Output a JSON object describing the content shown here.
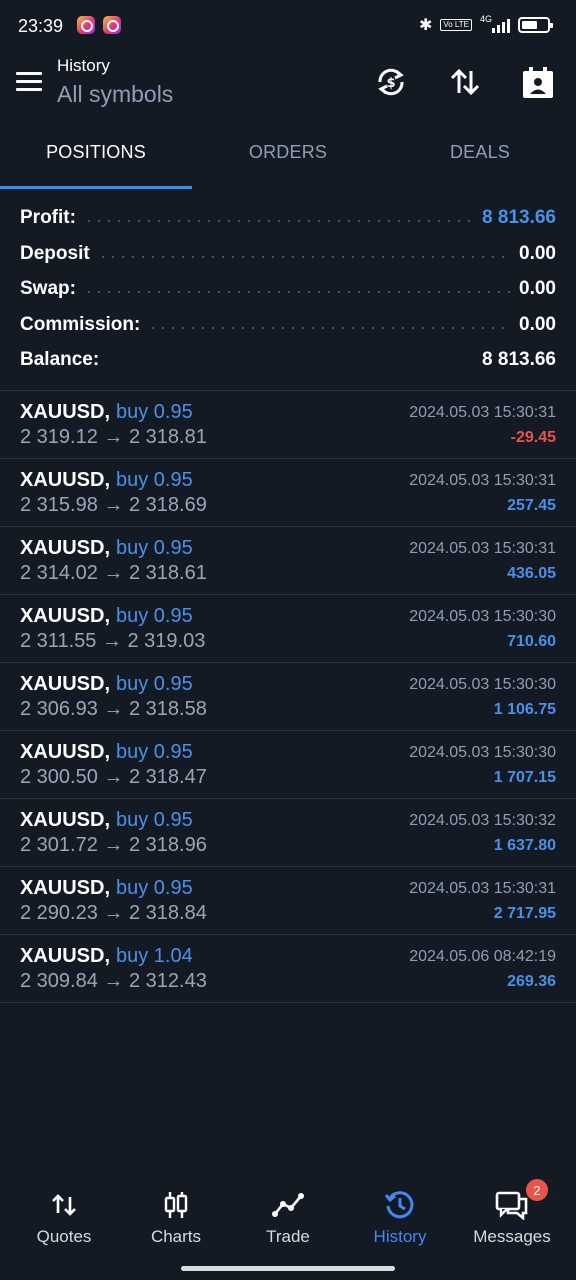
{
  "status_bar": {
    "time": "23:39",
    "network": "4G",
    "volte": "Vo LTE"
  },
  "header": {
    "title": "History",
    "subtitle": "All symbols",
    "icons": [
      "menu-icon",
      "currency-exchange-icon",
      "sort-icon",
      "calendar-icon"
    ]
  },
  "tabs": [
    {
      "label": "POSITIONS",
      "active": true
    },
    {
      "label": "ORDERS",
      "active": false
    },
    {
      "label": "DEALS",
      "active": false
    }
  ],
  "summary": {
    "profit": {
      "label": "Profit:",
      "value": "8 813.66"
    },
    "deposit": {
      "label": "Deposit",
      "value": "0.00"
    },
    "swap": {
      "label": "Swap:",
      "value": "0.00"
    },
    "commission": {
      "label": "Commission:",
      "value": "0.00"
    },
    "balance": {
      "label": "Balance:",
      "value": "8 813.66"
    }
  },
  "deals": [
    {
      "symbol": "XAUUSD,",
      "side": "buy 0.95",
      "prices": "2 319.12 → 2 318.81",
      "time": "2024.05.03 15:30:31",
      "profit": "-29.45",
      "negative": true
    },
    {
      "symbol": "XAUUSD,",
      "side": "buy 0.95",
      "prices": "2 315.98 → 2 318.69",
      "time": "2024.05.03 15:30:31",
      "profit": "257.45",
      "negative": false
    },
    {
      "symbol": "XAUUSD,",
      "side": "buy 0.95",
      "prices": "2 314.02 → 2 318.61",
      "time": "2024.05.03 15:30:31",
      "profit": "436.05",
      "negative": false
    },
    {
      "symbol": "XAUUSD,",
      "side": "buy 0.95",
      "prices": "2 311.55 → 2 319.03",
      "time": "2024.05.03 15:30:30",
      "profit": "710.60",
      "negative": false
    },
    {
      "symbol": "XAUUSD,",
      "side": "buy 0.95",
      "prices": "2 306.93 → 2 318.58",
      "time": "2024.05.03 15:30:30",
      "profit": "1 106.75",
      "negative": false
    },
    {
      "symbol": "XAUUSD,",
      "side": "buy 0.95",
      "prices": "2 300.50 → 2 318.47",
      "time": "2024.05.03 15:30:30",
      "profit": "1 707.15",
      "negative": false
    },
    {
      "symbol": "XAUUSD,",
      "side": "buy 0.95",
      "prices": "2 301.72 → 2 318.96",
      "time": "2024.05.03 15:30:32",
      "profit": "1 637.80",
      "negative": false
    },
    {
      "symbol": "XAUUSD,",
      "side": "buy 0.95",
      "prices": "2 290.23 → 2 318.84",
      "time": "2024.05.03 15:30:31",
      "profit": "2 717.95",
      "negative": false
    },
    {
      "symbol": "XAUUSD,",
      "side": "buy 1.04",
      "prices": "2 309.84 → 2 312.43",
      "time": "2024.05.06 08:42:19",
      "profit": "269.36",
      "negative": false
    }
  ],
  "bottom_nav": [
    {
      "label": "Quotes",
      "icon": "quotes-icon",
      "active": false
    },
    {
      "label": "Charts",
      "icon": "charts-icon",
      "active": false
    },
    {
      "label": "Trade",
      "icon": "trade-icon",
      "active": false
    },
    {
      "label": "History",
      "icon": "history-icon",
      "active": true
    },
    {
      "label": "Messages",
      "icon": "messages-icon",
      "active": false,
      "badge": "2"
    }
  ],
  "colors": {
    "background": "#141a24",
    "accent": "#3d8bf2",
    "profit_positive": "#4a90e8",
    "profit_negative": "#e8544a",
    "muted": "#8f9fb3"
  }
}
